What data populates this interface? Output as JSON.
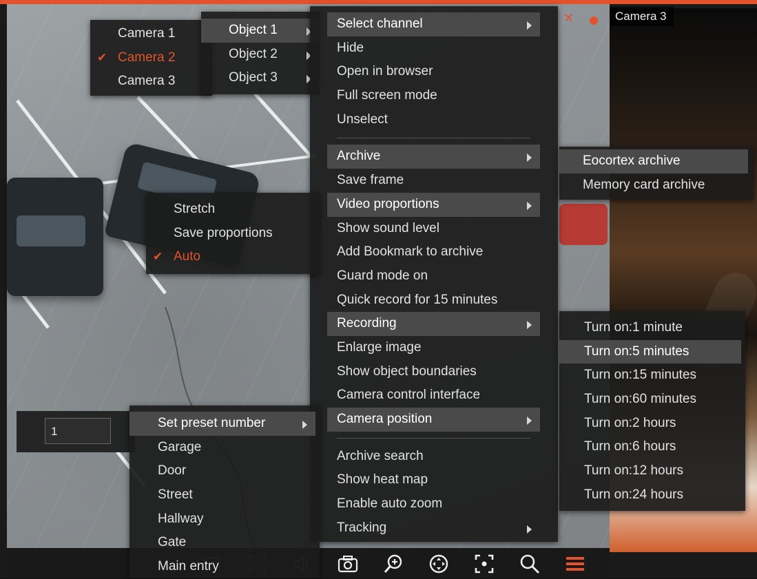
{
  "app": {
    "accent_color": "#e2522c"
  },
  "camera": {
    "title": "Camera 3"
  },
  "channels_menu": {
    "items": [
      {
        "label": "Camera 1",
        "checked": false
      },
      {
        "label": "Camera 2",
        "checked": true
      },
      {
        "label": "Camera 3",
        "checked": false
      }
    ]
  },
  "objects_menu": {
    "items": [
      {
        "label": "Object 1",
        "selected": true
      },
      {
        "label": "Object 2",
        "selected": false
      },
      {
        "label": "Object 3",
        "selected": false
      }
    ]
  },
  "main_menu": {
    "group1": [
      "Select channel",
      "Hide",
      "Open in browser",
      "Full screen mode",
      "Unselect"
    ],
    "group2": [
      "Archive",
      "Save frame",
      "Video proportions",
      "Show sound level",
      "Add Bookmark to archive",
      "Guard mode on",
      "Quick record for 15 minutes",
      "Recording",
      "Enlarge image",
      "Show object boundaries",
      "Camera control interface",
      "Camera position"
    ],
    "group3": [
      "Archive search",
      "Show heat map",
      "Enable auto zoom",
      "Tracking"
    ]
  },
  "archive_menu": {
    "items": [
      "Eocortex archive",
      "Memory card archive"
    ]
  },
  "proportions_menu": {
    "items": [
      {
        "label": "Stretch",
        "checked": false
      },
      {
        "label": "Save proportions",
        "checked": false
      },
      {
        "label": "Auto",
        "checked": true
      }
    ]
  },
  "recording_menu": {
    "items": [
      "Turn on:1 minute",
      "Turn on:5 minutes",
      "Turn on:15 minutes",
      "Turn on:60 minutes",
      "Turn on:2 hours",
      "Turn on:6 hours",
      "Turn on:12 hours",
      "Turn on:24 hours"
    ]
  },
  "preset_menu": {
    "input_value": "1",
    "items": [
      "Set preset number",
      "Garage",
      "Door",
      "Street",
      "Hallway",
      "Gate",
      "Main entry"
    ]
  },
  "toolbar": {
    "icons": [
      "display-icon",
      "fullscreen-icon",
      "volume-icon",
      "camera-snapshot-icon",
      "zoom-in-icon",
      "ptz-icon",
      "focus-icon",
      "search-icon",
      "menu-icon"
    ]
  }
}
